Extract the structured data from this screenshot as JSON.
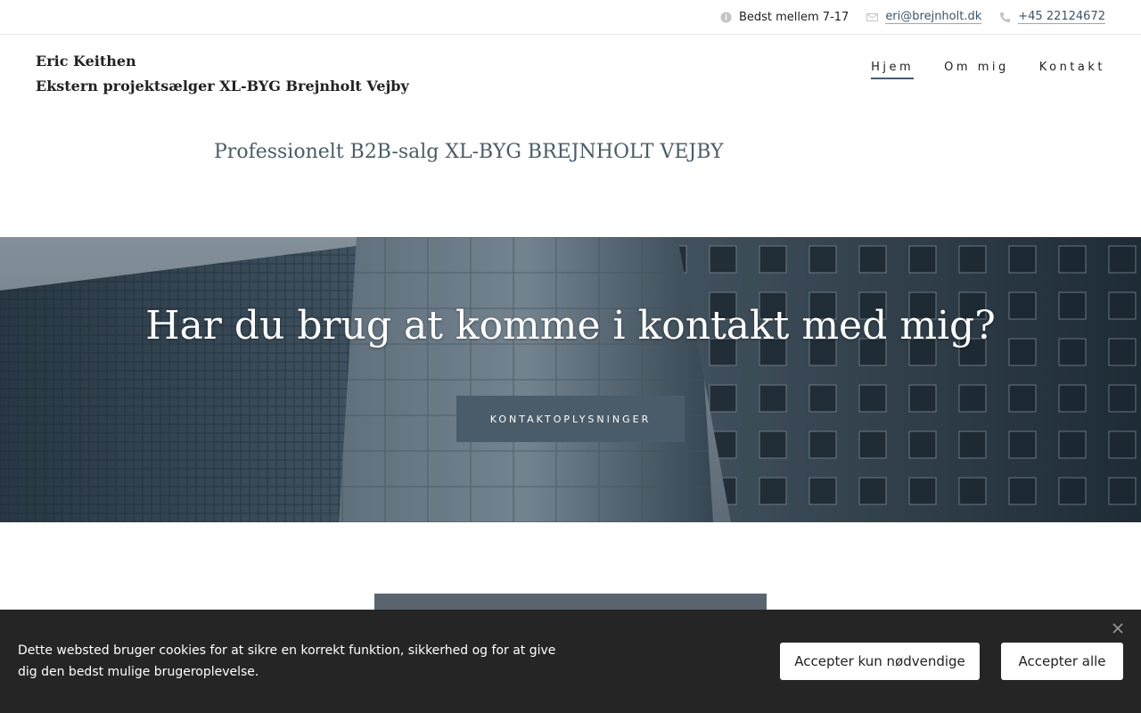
{
  "topbar": {
    "hours": "Bedst mellem 7-17",
    "email": "eri@brejnholt.dk",
    "phone": "+45 22124672"
  },
  "header": {
    "name": "Eric Keithen",
    "role": "Ekstern projektsælger XL-BYG Brejnholt Vejby"
  },
  "nav": {
    "items": [
      {
        "label": "Hjem",
        "active": true
      },
      {
        "label": "Om mig",
        "active": false
      },
      {
        "label": "Kontakt",
        "active": false
      }
    ]
  },
  "tagline": "Professionelt B2B-salg XL-BYG BREJNHOLT VEJBY",
  "hero": {
    "title": "Har du brug at komme i kontakt med mig?",
    "button": "KONTAKTOPLYSNINGER"
  },
  "cookie": {
    "text": "Dette websted bruger cookies for at sikre en korrekt funktion, sikkerhed og for at give dig den bedst mulige brugeroplevelse.",
    "accept_necessary": "Accepter kun nødvendige",
    "accept_all": "Accepter alle",
    "close_icon": "close-icon"
  },
  "colors": {
    "accent": "#4a5c6a",
    "cookie_bg": "#252525"
  }
}
